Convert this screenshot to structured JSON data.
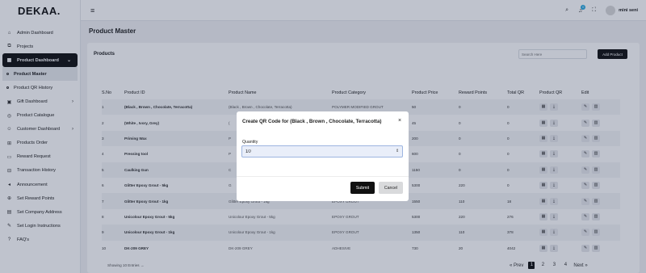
{
  "brand": {
    "logo": "DEKAA."
  },
  "topbar": {
    "user_name": "mini seni",
    "notification_count": "0"
  },
  "sidebar": {
    "items": [
      {
        "label": "Admin Dashboard",
        "icon": "home-icon"
      },
      {
        "label": "Projects",
        "icon": "projects-icon"
      },
      {
        "label": "Product Dashboard",
        "icon": "grid-icon"
      },
      {
        "label": "Product Master",
        "icon": "dot-icon"
      },
      {
        "label": "Product QR History",
        "icon": "dot-icon"
      },
      {
        "label": "Gift Dashboard",
        "icon": "gift-icon"
      },
      {
        "label": "Product Catalogue",
        "icon": "catalogue-icon"
      },
      {
        "label": "Customer Dashboard",
        "icon": "customer-icon"
      },
      {
        "label": "Products Order",
        "icon": "cart-icon"
      },
      {
        "label": "Reward Request",
        "icon": "reward-icon"
      },
      {
        "label": "Transaction History",
        "icon": "history-icon"
      },
      {
        "label": "Announcement",
        "icon": "megaphone-icon"
      },
      {
        "label": "Set Reward Points",
        "icon": "points-icon"
      },
      {
        "label": "Set Company Address",
        "icon": "building-icon"
      },
      {
        "label": "Set Login Instructions",
        "icon": "instructions-icon"
      },
      {
        "label": "FAQ's",
        "icon": "help-icon"
      }
    ]
  },
  "main": {
    "page_title": "Product Master",
    "card_title": "Products",
    "search_placeholder": "Search Here",
    "add_button": "Add Product",
    "columns": [
      "S.No",
      "Product ID",
      "Product Name",
      "Product Category",
      "Product Price",
      "Reward Points",
      "Total QR",
      "Product QR",
      "Edit"
    ],
    "rows": [
      {
        "sno": "1",
        "id": "(Black , Brown , Chocolate, Terracotta)",
        "name": "(Black , Brown , Chocolate, Terracotta)",
        "category": "POLYMER MODIFIED GROUT",
        "price": "50",
        "points": "0",
        "qr": "0"
      },
      {
        "sno": "2",
        "id": "(White , Ivory, Grey)",
        "name": "(",
        "category": "",
        "price": "45",
        "points": "0",
        "qr": "0"
      },
      {
        "sno": "3",
        "id": "Priming Wax",
        "name": "P",
        "category": "",
        "price": "200",
        "points": "0",
        "qr": "0"
      },
      {
        "sno": "4",
        "id": "Pressing tool",
        "name": "P",
        "category": "",
        "price": "600",
        "points": "0",
        "qr": "0"
      },
      {
        "sno": "5",
        "id": "Caulking Gun",
        "name": "C",
        "category": "",
        "price": "1150",
        "points": "0",
        "qr": "0"
      },
      {
        "sno": "6",
        "id": "Glitter Epoxy Grout - 5kg",
        "name": "G",
        "category": "",
        "price": "5300",
        "points": "220",
        "qr": "0"
      },
      {
        "sno": "7",
        "id": "Glitter Epoxy Grout - 1kg",
        "name": "Glitter Epoxy Grout - 1kg",
        "category": "EPOXY GROUT",
        "price": "1550",
        "points": "110",
        "qr": "18"
      },
      {
        "sno": "8",
        "id": "Unicolour Epoxy Grout - 5kg",
        "name": "Unicolour Epoxy Grout - 5kg",
        "category": "EPOXY GROUT",
        "price": "5300",
        "points": "220",
        "qr": "276"
      },
      {
        "sno": "9",
        "id": "Unicolour Epoxy Grout - 1kg",
        "name": "Unicolour Epoxy Grout - 1kg",
        "category": "EPOXY GROUT",
        "price": "1350",
        "points": "110",
        "qr": "378"
      },
      {
        "sno": "10",
        "id": "DK-209 GREY",
        "name": "DK-209 GREY",
        "category": "ADHESIVE",
        "price": "730",
        "points": "20",
        "qr": "4042"
      }
    ],
    "footer": "Showing 10 Entries",
    "pager": {
      "prev": "Prev",
      "pages": [
        "1",
        "2",
        "3",
        "4"
      ],
      "next": "Next"
    }
  },
  "modal": {
    "title": "Create QR Code for (Black , Brown , Chocolate, Terracotta)",
    "quantity_label": "Quantity",
    "quantity_value": "10",
    "submit": "Submit",
    "cancel": "Cancel"
  }
}
